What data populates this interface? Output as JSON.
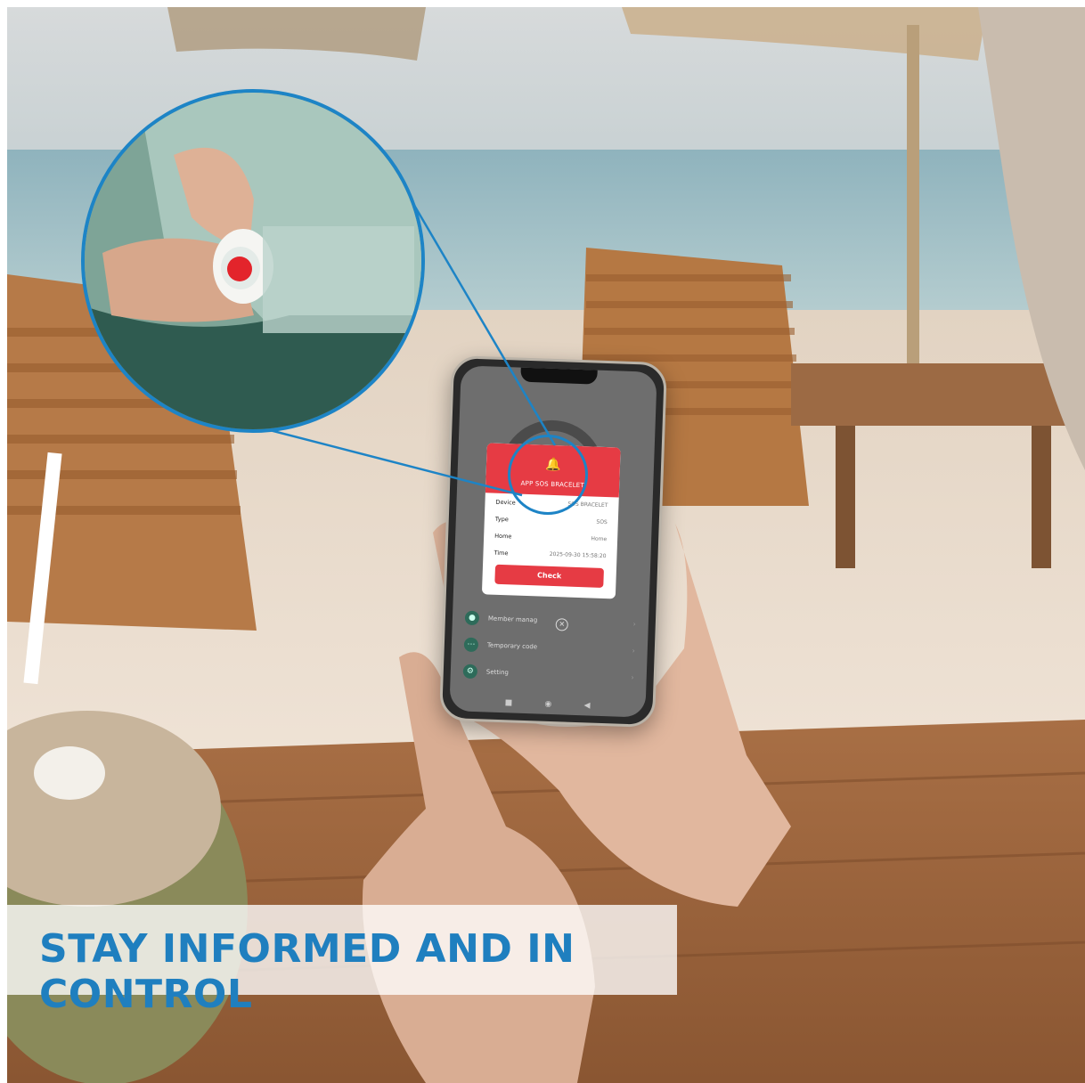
{
  "app": {
    "popup_title": "APP SOS BRACELET",
    "fields": [
      {
        "label": "Device",
        "value": "SOS BRACELET"
      },
      {
        "label": "Type",
        "value": "SOS"
      },
      {
        "label": "Home",
        "value": "Home"
      },
      {
        "label": "Time",
        "value": "2025-09-30 15:58:20"
      }
    ],
    "check_label": "Check",
    "menu": [
      "Member manag",
      "Temporary code",
      "Setting"
    ]
  },
  "caption": "STAY INFORMED AND IN CONTROL",
  "colors": {
    "accent": "#1d84c6",
    "alert": "#e63b44",
    "caption_text": "#1f7fbf"
  }
}
